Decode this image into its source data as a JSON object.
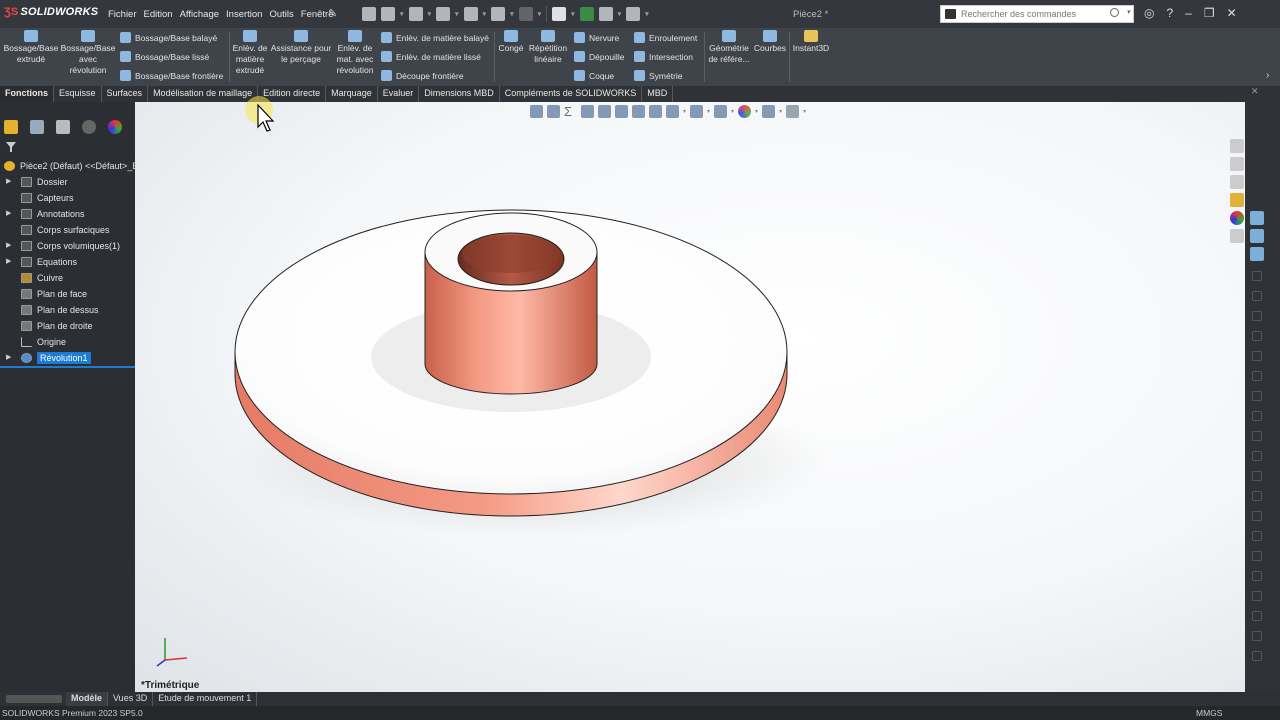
{
  "app": {
    "logo": "SOLIDWORKS",
    "doc_title": "Pièce2 *"
  },
  "menu": [
    "Fichier",
    "Edition",
    "Affichage",
    "Insertion",
    "Outils",
    "Fenêtre"
  ],
  "search": {
    "placeholder": "Rechercher des commandes"
  },
  "ribbon": {
    "bossage_extrude": "Bossage/Base extrudé",
    "bossage_revolution": "Bossage/Base avec révolution",
    "bossage_balaye": "Bossage/Base balayé",
    "bossage_lisse": "Bossage/Base lissé",
    "bossage_frontiere": "Bossage/Base frontière",
    "enlev_extrude": "Enlèv. de matière extrudé",
    "assistance_percage": "Assistance pour le perçage",
    "enlev_revolution": "Enlèv. de mat. avec révolution",
    "enlev_balaye": "Enlèv. de matière balayé",
    "enlev_lisse": "Enlèv. de matière lissé",
    "decoupe_frontiere": "Découpe frontière",
    "conge": "Congé",
    "repetition": "Répétition linéaire",
    "nervure": "Nervure",
    "depouille": "Dépouille",
    "coque": "Coque",
    "enroulement": "Enroulement",
    "intersection": "Intersection",
    "symetrie": "Symétrie",
    "geometrie": "Géométrie de référe...",
    "courbes": "Courbes",
    "instant3d": "Instant3D"
  },
  "tabs": [
    "Fonctions",
    "Esquisse",
    "Surfaces",
    "Modélisation de maillage",
    "Edition directe",
    "Marquage",
    "Evaluer",
    "Dimensions MBD",
    "Compléments de SOLIDWORKS",
    "MBD"
  ],
  "tree": {
    "root": "Pièce2 (Défaut) <<Défaut>_E",
    "items": [
      "Dossier",
      "Capteurs",
      "Annotations",
      "Corps surfaciques",
      "Corps volumiques(1)",
      "Equations",
      "Cuivre",
      "Plan de face",
      "Plan de dessus",
      "Plan de droite",
      "Origine",
      "Révolution1"
    ]
  },
  "viewport": {
    "view_label": "*Trimétrique"
  },
  "bottom_tabs": [
    "Modèle",
    "Vues 3D",
    "Etude de mouvement 1"
  ],
  "status": {
    "left": "SOLIDWORKS Premium 2023 SP5.0",
    "units": "MMGS"
  },
  "colors": {
    "copper": "#ee8a70",
    "selection": "#1d7bd4"
  }
}
